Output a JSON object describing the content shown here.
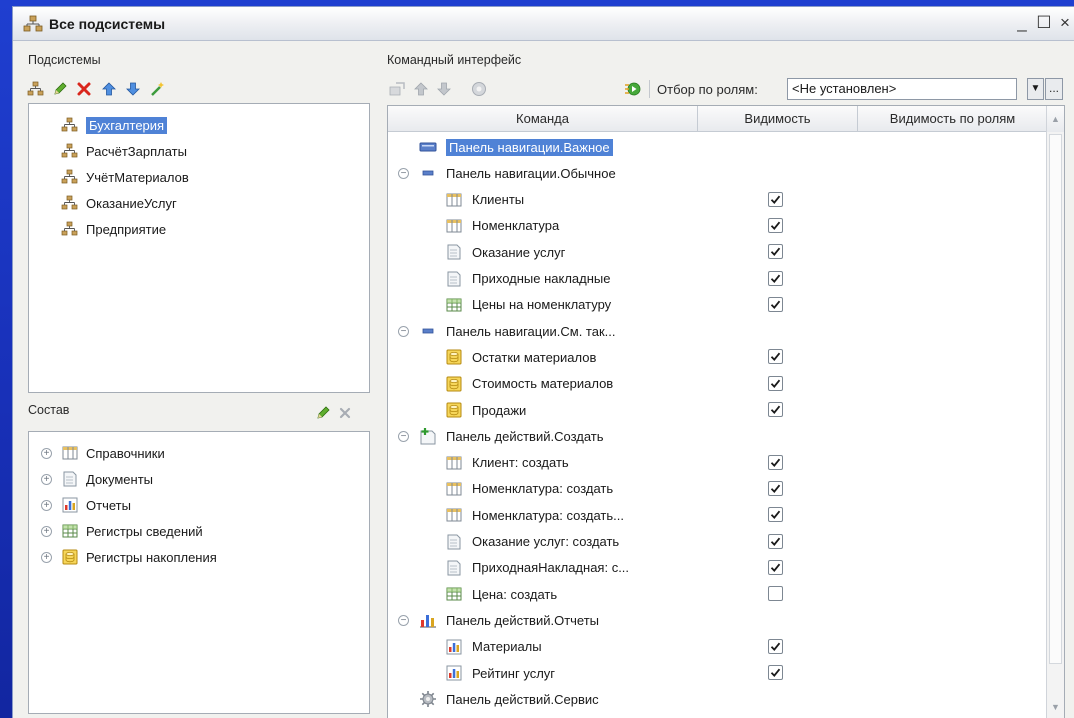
{
  "window": {
    "title": "Все подсистемы",
    "minimize": "_",
    "maximize": "☐",
    "close": "×"
  },
  "subsystems": {
    "label": "Подсистемы",
    "items": [
      {
        "label": "Бухгалтерия",
        "selected": true
      },
      {
        "label": "РасчётЗарплаты",
        "selected": false
      },
      {
        "label": "УчётМатериалов",
        "selected": false
      },
      {
        "label": "ОказаниеУслуг",
        "selected": false
      },
      {
        "label": "Предприятие",
        "selected": false
      }
    ]
  },
  "composition": {
    "label": "Состав",
    "items": [
      {
        "label": "Справочники",
        "icon": "catalog-icon"
      },
      {
        "label": "Документы",
        "icon": "document-icon"
      },
      {
        "label": "Отчеты",
        "icon": "report-icon"
      },
      {
        "label": "Регистры сведений",
        "icon": "info-register-icon"
      },
      {
        "label": "Регистры накопления",
        "icon": "accumulation-register-icon"
      }
    ]
  },
  "command_interface": {
    "label": "Командный интерфейс",
    "filter_label": "Отбор по ролям:",
    "filter_value": "<Не установлен>",
    "filter_more": "...",
    "columns": [
      "Команда",
      "Видимость",
      "Видимость по ролям"
    ],
    "rows": [
      {
        "label": "Панель навигации.Важное",
        "level": 0,
        "icon": "nav-panel-icon",
        "group": false,
        "selected": true,
        "checked": null
      },
      {
        "label": "Панель навигации.Обычное",
        "level": 0,
        "icon": "nav-panel-small-icon",
        "group": true,
        "selected": false,
        "checked": null
      },
      {
        "label": "Клиенты",
        "level": 1,
        "icon": "catalog-icon",
        "group": false,
        "selected": false,
        "checked": true
      },
      {
        "label": "Номенклатура",
        "level": 1,
        "icon": "catalog-icon",
        "group": false,
        "selected": false,
        "checked": true
      },
      {
        "label": "Оказание услуг",
        "level": 1,
        "icon": "document-icon",
        "group": false,
        "selected": false,
        "checked": true
      },
      {
        "label": "Приходные накладные",
        "level": 1,
        "icon": "document-icon",
        "group": false,
        "selected": false,
        "checked": true
      },
      {
        "label": "Цены на номенклатуру",
        "level": 1,
        "icon": "info-register-icon",
        "group": false,
        "selected": false,
        "checked": true
      },
      {
        "label": "Панель навигации.См. так...",
        "level": 0,
        "icon": "nav-panel-small-icon",
        "group": true,
        "selected": false,
        "checked": null
      },
      {
        "label": "Остатки материалов",
        "level": 1,
        "icon": "accumulation-register-icon",
        "group": false,
        "selected": false,
        "checked": true
      },
      {
        "label": "Стоимость материалов",
        "level": 1,
        "icon": "accumulation-register-icon",
        "group": false,
        "selected": false,
        "checked": true
      },
      {
        "label": "Продажи",
        "level": 1,
        "icon": "accumulation-register-icon",
        "group": false,
        "selected": false,
        "checked": true
      },
      {
        "label": "Панель действий.Создать",
        "level": 0,
        "icon": "create-panel-icon",
        "group": true,
        "selected": false,
        "checked": null
      },
      {
        "label": "Клиент: создать",
        "level": 1,
        "icon": "catalog-icon",
        "group": false,
        "selected": false,
        "checked": true
      },
      {
        "label": "Номенклатура: создать",
        "level": 1,
        "icon": "catalog-icon",
        "group": false,
        "selected": false,
        "checked": true
      },
      {
        "label": "Номенклатура: создать...",
        "level": 1,
        "icon": "catalog-icon",
        "group": false,
        "selected": false,
        "checked": true
      },
      {
        "label": "Оказание услуг: создать",
        "level": 1,
        "icon": "document-icon",
        "group": false,
        "selected": false,
        "checked": true
      },
      {
        "label": "ПриходнаяНакладная: с...",
        "level": 1,
        "icon": "document-icon",
        "group": false,
        "selected": false,
        "checked": true
      },
      {
        "label": "Цена: создать",
        "level": 1,
        "icon": "info-register-icon",
        "group": false,
        "selected": false,
        "checked": false
      },
      {
        "label": "Панель действий.Отчеты",
        "level": 0,
        "icon": "reports-panel-icon",
        "group": true,
        "selected": false,
        "checked": null
      },
      {
        "label": "Материалы",
        "level": 1,
        "icon": "report-icon",
        "group": false,
        "selected": false,
        "checked": true
      },
      {
        "label": "Рейтинг услуг",
        "level": 1,
        "icon": "report-icon",
        "group": false,
        "selected": false,
        "checked": true
      },
      {
        "label": "Панель действий.Сервис",
        "level": 0,
        "icon": "gear-icon",
        "group": false,
        "selected": false,
        "checked": null
      }
    ]
  }
}
